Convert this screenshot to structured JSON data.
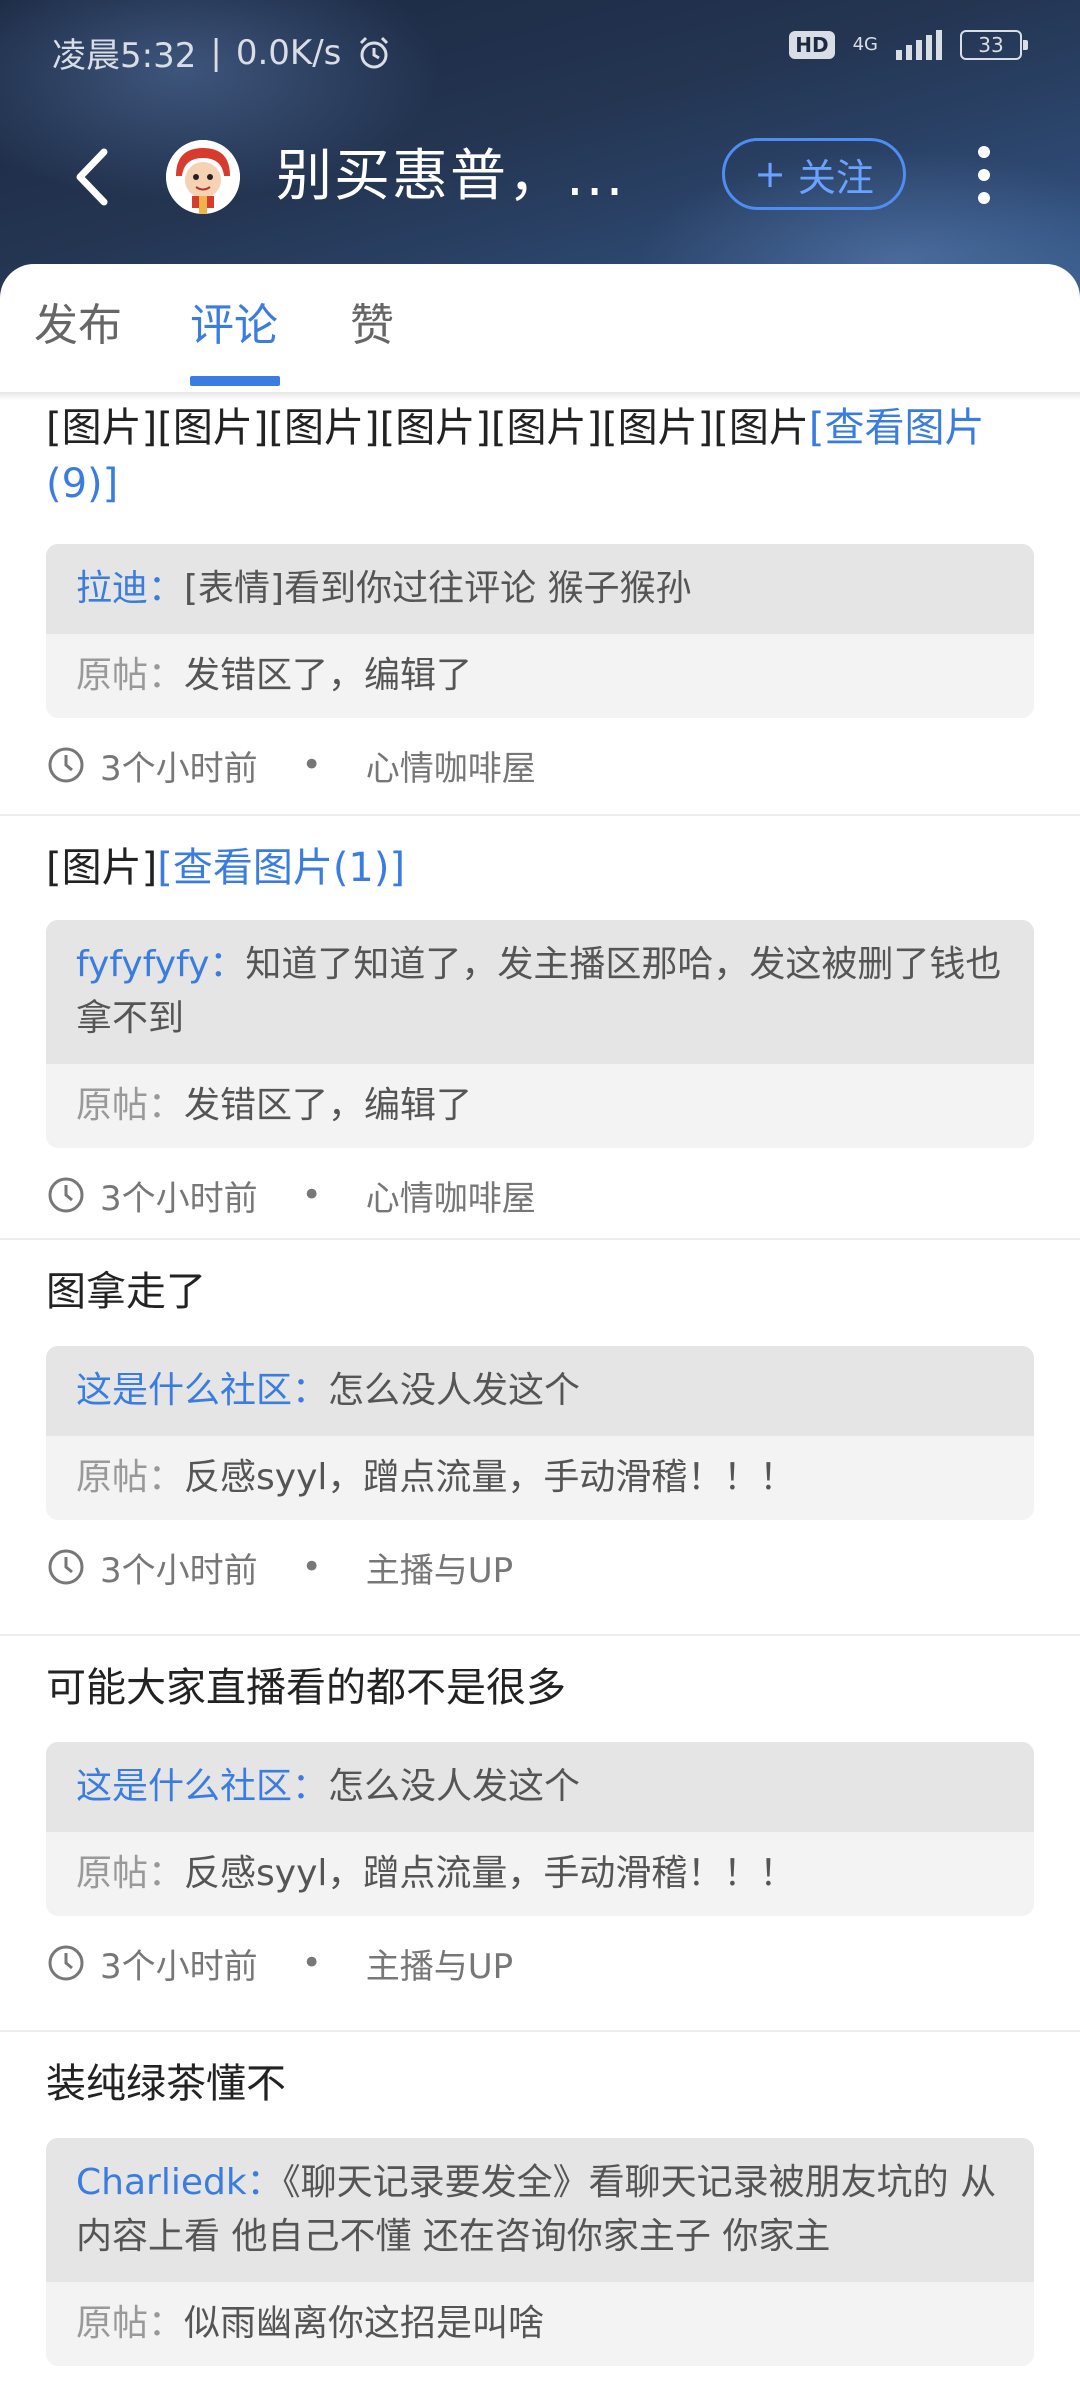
{
  "status_bar": {
    "time": "凌晨5:32",
    "separator": "|",
    "speed": "0.0K/s",
    "hd": "HD",
    "network": "4G",
    "battery": "33"
  },
  "header": {
    "title": "别买惠普，...",
    "follow_plus": "+",
    "follow_label": "关注"
  },
  "tabs": [
    {
      "label": "发布",
      "active": false
    },
    {
      "label": "评论",
      "active": true
    },
    {
      "label": "赞",
      "active": false
    }
  ],
  "comments": [
    {
      "text": "[图片][图片][图片][图片][图片][图片][图片",
      "link": "[查看图片(9)]",
      "reply_user": "拉迪：",
      "reply_text": "[表情]看到你过往评论 猴子猴孙",
      "orig_label": "原帖：",
      "orig_text": "发错区了，编辑了",
      "time": "3个小时前",
      "dot": "•",
      "forum": "心情咖啡屋"
    },
    {
      "text": "[图片]",
      "link": "[查看图片(1)]",
      "reply_user": "fyfyfyfy：",
      "reply_text": "知道了知道了，发主播区那哈，发这被删了钱也拿不到",
      "orig_label": "原帖：",
      "orig_text": "发错区了，编辑了",
      "time": "3个小时前",
      "dot": "•",
      "forum": "心情咖啡屋"
    },
    {
      "text": "图拿走了",
      "link": "",
      "reply_user": "这是什么社区：",
      "reply_text": "怎么没人发这个",
      "orig_label": "原帖：",
      "orig_text": "反感syyl，蹭点流量，手动滑稽！！！",
      "time": "3个小时前",
      "dot": "•",
      "forum": "主播与UP"
    },
    {
      "text": "可能大家直播看的都不是很多",
      "link": "",
      "reply_user": "这是什么社区：",
      "reply_text": "怎么没人发这个",
      "orig_label": "原帖：",
      "orig_text": "反感syyl，蹭点流量，手动滑稽！！！",
      "time": "3个小时前",
      "dot": "•",
      "forum": "主播与UP"
    },
    {
      "text": "装纯绿茶懂不",
      "link": "",
      "reply_user": "Charliedk：",
      "reply_text": "《聊天记录要发全》看聊天记录被朋友坑的 从内容上看 他自己不懂 还在咨询你家主子 你家主",
      "orig_label": "原帖：",
      "orig_text": "似雨幽离你这招是叫啥",
      "time": "",
      "dot": "",
      "forum": ""
    }
  ],
  "colors": {
    "accent": "#3b7ce0",
    "header_bg": "#243552"
  }
}
